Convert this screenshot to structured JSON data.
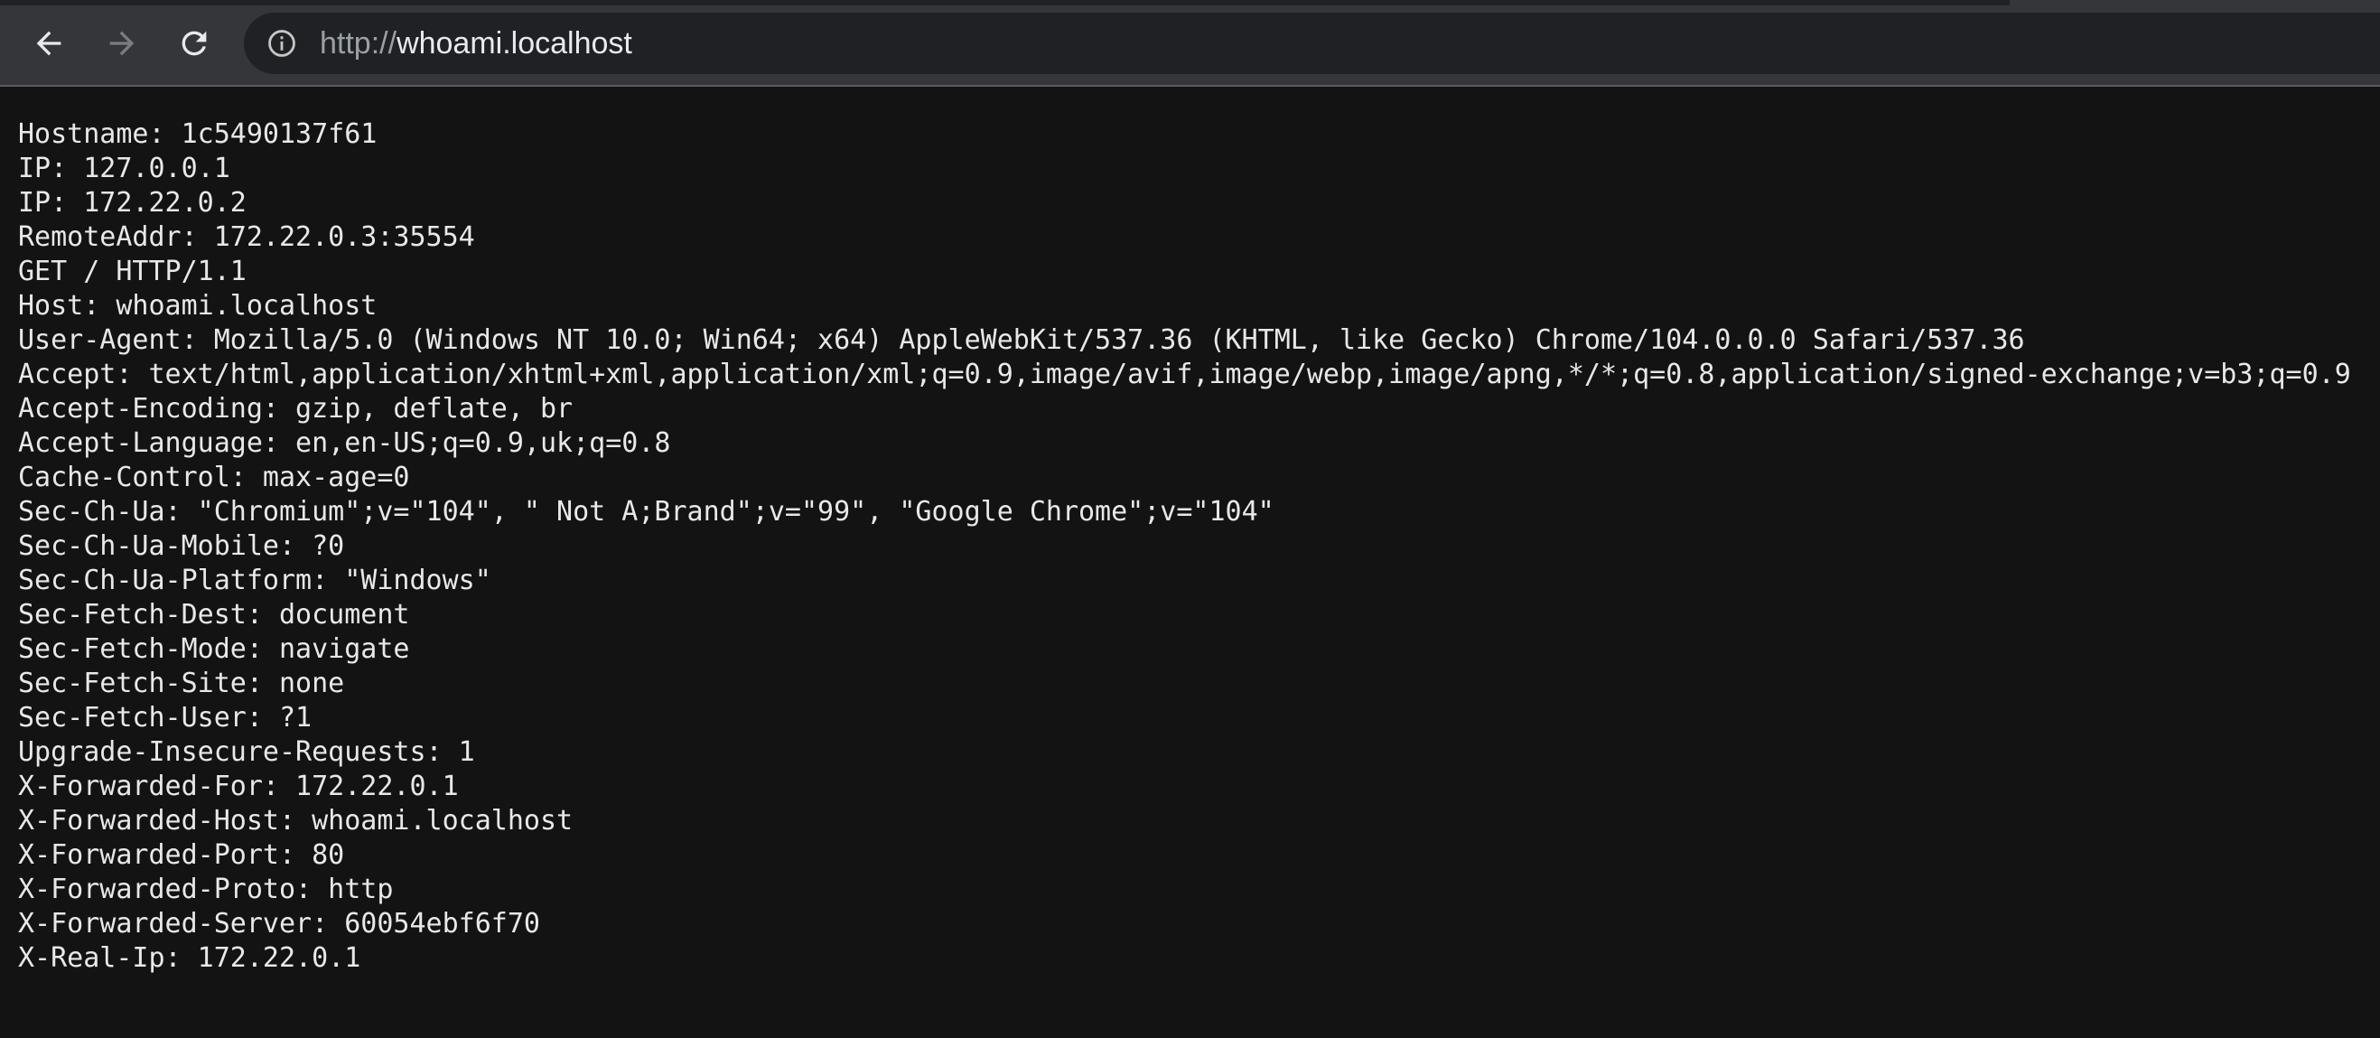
{
  "browser": {
    "address": {
      "scheme": "http://",
      "host": "whoami.localhost"
    },
    "icons": {
      "back": "back-arrow-icon",
      "forward": "forward-arrow-icon",
      "reload": "reload-icon",
      "site_info": "info-icon"
    }
  },
  "response": {
    "lines": [
      "Hostname: 1c5490137f61",
      "IP: 127.0.0.1",
      "IP: 172.22.0.2",
      "RemoteAddr: 172.22.0.3:35554",
      "GET / HTTP/1.1",
      "Host: whoami.localhost",
      "User-Agent: Mozilla/5.0 (Windows NT 10.0; Win64; x64) AppleWebKit/537.36 (KHTML, like Gecko) Chrome/104.0.0.0 Safari/537.36",
      "Accept: text/html,application/xhtml+xml,application/xml;q=0.9,image/avif,image/webp,image/apng,*/*;q=0.8,application/signed-exchange;v=b3;q=0.9",
      "Accept-Encoding: gzip, deflate, br",
      "Accept-Language: en,en-US;q=0.9,uk;q=0.8",
      "Cache-Control: max-age=0",
      "Sec-Ch-Ua: \"Chromium\";v=\"104\", \" Not A;Brand\";v=\"99\", \"Google Chrome\";v=\"104\"",
      "Sec-Ch-Ua-Mobile: ?0",
      "Sec-Ch-Ua-Platform: \"Windows\"",
      "Sec-Fetch-Dest: document",
      "Sec-Fetch-Mode: navigate",
      "Sec-Fetch-Site: none",
      "Sec-Fetch-User: ?1",
      "Upgrade-Insecure-Requests: 1",
      "X-Forwarded-For: 172.22.0.1",
      "X-Forwarded-Host: whoami.localhost",
      "X-Forwarded-Port: 80",
      "X-Forwarded-Proto: http",
      "X-Forwarded-Server: 60054ebf6f70",
      "X-Real-Ip: 172.22.0.1"
    ]
  }
}
